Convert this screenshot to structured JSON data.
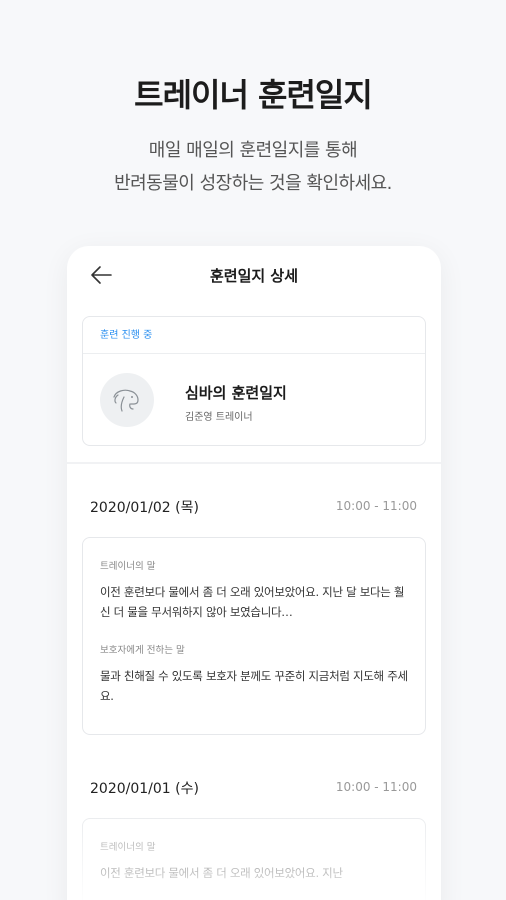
{
  "promo": {
    "title": "트레이너 훈련일지",
    "subtitle_line1": "매일 매일의 훈련일지를 통해",
    "subtitle_line2": "반려동물이 성장하는 것을 확인하세요."
  },
  "header": {
    "back_icon": "arrow-left-icon",
    "title": "훈련일지 상세"
  },
  "summary": {
    "status": "훈련 진행 중",
    "status_color": "#2a8ff0",
    "avatar_icon": "dog-icon",
    "journal_title": "심바의 훈련일지",
    "trainer": "김준영 트레이너"
  },
  "entries": [
    {
      "date": "2020/01/02 (목)",
      "time": "10:00 - 11:00",
      "trainer_label": "트레이너의 말",
      "trainer_text": "이전 훈련보다 물에서 좀 더 오래 있어보았어요. 지난 달 보다는 훨신 더 물을 무서워하지 않아 보였습니다…",
      "guardian_label": "보호자에게 전하는 말",
      "guardian_text": "물과 친해질 수 있도록 보호자 분께도 꾸준히 지금처럼 지도해 주세요."
    },
    {
      "date": "2020/01/01 (수)",
      "time": "10:00 - 11:00",
      "trainer_label": "트레이너의 말",
      "trainer_text": "이전 훈련보다 물에서 좀 더 오래 있어보았어요. 지난"
    }
  ]
}
